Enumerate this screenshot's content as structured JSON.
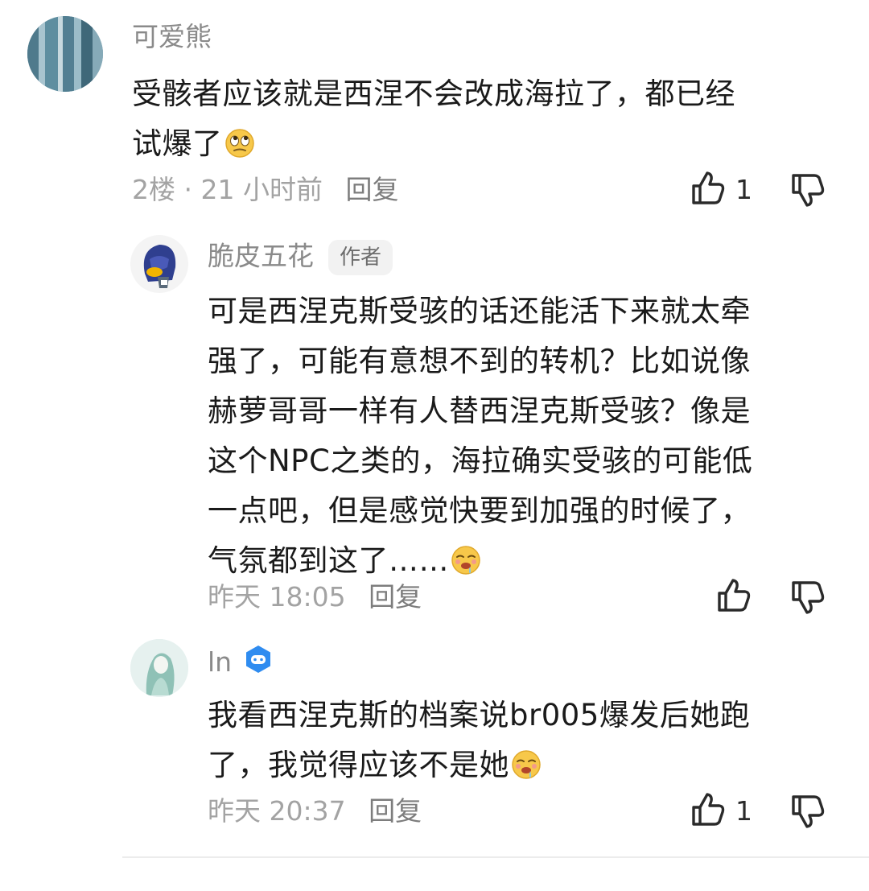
{
  "comments": [
    {
      "username": "可爱熊",
      "content_lines": [
        "受骸者应该就是西涅不会改成海拉了，都已经",
        "试爆了"
      ],
      "emoji": "eye-roll-emoji",
      "floor": "2楼",
      "separator": "·",
      "time": "21 小时前",
      "reply_label": "回复",
      "like_count": "1"
    },
    {
      "username": "脆皮五花",
      "badge": "作者",
      "content_lines": [
        "可是西涅克斯受骇的话还能活下来就太牵",
        "强了，可能有意想不到的转机？比如说像",
        "赫萝哥哥一样有人替西涅克斯受骇？像是",
        "这个NPC之类的，海拉确实受骇的可能低",
        "一点吧，但是感觉快要到加强的时候了，",
        "气氛都到这了……"
      ],
      "emoji": "drooling-emoji",
      "time": "昨天 18:05",
      "reply_label": "回复"
    },
    {
      "username": "ln",
      "badge_icon": "game-controller-icon",
      "content_lines": [
        "我看西涅克斯的档案说br005爆发后她跑",
        "了，我觉得应该不是她"
      ],
      "emoji": "drooling-emoji",
      "time": "昨天 20:37",
      "reply_label": "回复",
      "like_count": "1"
    }
  ],
  "colors": {
    "text": "#1a1a1a",
    "muted": "#8a8a8a",
    "meta": "#a3a3a3",
    "badge_bg": "#f2f2f2",
    "game_badge": "#2f8cf0"
  }
}
